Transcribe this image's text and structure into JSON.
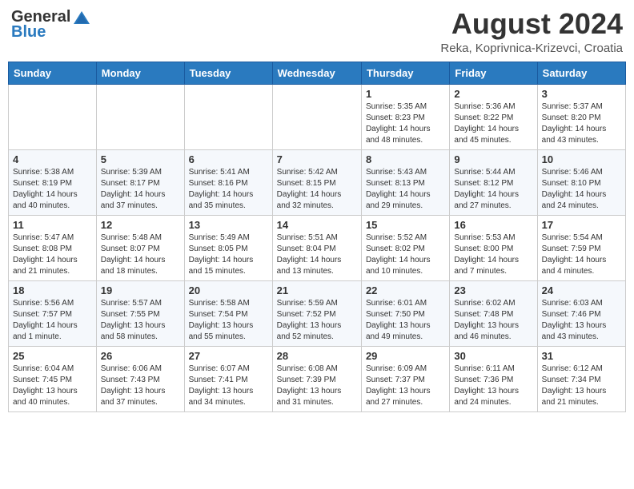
{
  "header": {
    "logo_general": "General",
    "logo_blue": "Blue",
    "month_year": "August 2024",
    "location": "Reka, Koprivnica-Krizevci, Croatia"
  },
  "weekdays": [
    "Sunday",
    "Monday",
    "Tuesday",
    "Wednesday",
    "Thursday",
    "Friday",
    "Saturday"
  ],
  "weeks": [
    [
      {
        "day": "",
        "info": ""
      },
      {
        "day": "",
        "info": ""
      },
      {
        "day": "",
        "info": ""
      },
      {
        "day": "",
        "info": ""
      },
      {
        "day": "1",
        "info": "Sunrise: 5:35 AM\nSunset: 8:23 PM\nDaylight: 14 hours\nand 48 minutes."
      },
      {
        "day": "2",
        "info": "Sunrise: 5:36 AM\nSunset: 8:22 PM\nDaylight: 14 hours\nand 45 minutes."
      },
      {
        "day": "3",
        "info": "Sunrise: 5:37 AM\nSunset: 8:20 PM\nDaylight: 14 hours\nand 43 minutes."
      }
    ],
    [
      {
        "day": "4",
        "info": "Sunrise: 5:38 AM\nSunset: 8:19 PM\nDaylight: 14 hours\nand 40 minutes."
      },
      {
        "day": "5",
        "info": "Sunrise: 5:39 AM\nSunset: 8:17 PM\nDaylight: 14 hours\nand 37 minutes."
      },
      {
        "day": "6",
        "info": "Sunrise: 5:41 AM\nSunset: 8:16 PM\nDaylight: 14 hours\nand 35 minutes."
      },
      {
        "day": "7",
        "info": "Sunrise: 5:42 AM\nSunset: 8:15 PM\nDaylight: 14 hours\nand 32 minutes."
      },
      {
        "day": "8",
        "info": "Sunrise: 5:43 AM\nSunset: 8:13 PM\nDaylight: 14 hours\nand 29 minutes."
      },
      {
        "day": "9",
        "info": "Sunrise: 5:44 AM\nSunset: 8:12 PM\nDaylight: 14 hours\nand 27 minutes."
      },
      {
        "day": "10",
        "info": "Sunrise: 5:46 AM\nSunset: 8:10 PM\nDaylight: 14 hours\nand 24 minutes."
      }
    ],
    [
      {
        "day": "11",
        "info": "Sunrise: 5:47 AM\nSunset: 8:08 PM\nDaylight: 14 hours\nand 21 minutes."
      },
      {
        "day": "12",
        "info": "Sunrise: 5:48 AM\nSunset: 8:07 PM\nDaylight: 14 hours\nand 18 minutes."
      },
      {
        "day": "13",
        "info": "Sunrise: 5:49 AM\nSunset: 8:05 PM\nDaylight: 14 hours\nand 15 minutes."
      },
      {
        "day": "14",
        "info": "Sunrise: 5:51 AM\nSunset: 8:04 PM\nDaylight: 14 hours\nand 13 minutes."
      },
      {
        "day": "15",
        "info": "Sunrise: 5:52 AM\nSunset: 8:02 PM\nDaylight: 14 hours\nand 10 minutes."
      },
      {
        "day": "16",
        "info": "Sunrise: 5:53 AM\nSunset: 8:00 PM\nDaylight: 14 hours\nand 7 minutes."
      },
      {
        "day": "17",
        "info": "Sunrise: 5:54 AM\nSunset: 7:59 PM\nDaylight: 14 hours\nand 4 minutes."
      }
    ],
    [
      {
        "day": "18",
        "info": "Sunrise: 5:56 AM\nSunset: 7:57 PM\nDaylight: 14 hours\nand 1 minute."
      },
      {
        "day": "19",
        "info": "Sunrise: 5:57 AM\nSunset: 7:55 PM\nDaylight: 13 hours\nand 58 minutes."
      },
      {
        "day": "20",
        "info": "Sunrise: 5:58 AM\nSunset: 7:54 PM\nDaylight: 13 hours\nand 55 minutes."
      },
      {
        "day": "21",
        "info": "Sunrise: 5:59 AM\nSunset: 7:52 PM\nDaylight: 13 hours\nand 52 minutes."
      },
      {
        "day": "22",
        "info": "Sunrise: 6:01 AM\nSunset: 7:50 PM\nDaylight: 13 hours\nand 49 minutes."
      },
      {
        "day": "23",
        "info": "Sunrise: 6:02 AM\nSunset: 7:48 PM\nDaylight: 13 hours\nand 46 minutes."
      },
      {
        "day": "24",
        "info": "Sunrise: 6:03 AM\nSunset: 7:46 PM\nDaylight: 13 hours\nand 43 minutes."
      }
    ],
    [
      {
        "day": "25",
        "info": "Sunrise: 6:04 AM\nSunset: 7:45 PM\nDaylight: 13 hours\nand 40 minutes."
      },
      {
        "day": "26",
        "info": "Sunrise: 6:06 AM\nSunset: 7:43 PM\nDaylight: 13 hours\nand 37 minutes."
      },
      {
        "day": "27",
        "info": "Sunrise: 6:07 AM\nSunset: 7:41 PM\nDaylight: 13 hours\nand 34 minutes."
      },
      {
        "day": "28",
        "info": "Sunrise: 6:08 AM\nSunset: 7:39 PM\nDaylight: 13 hours\nand 31 minutes."
      },
      {
        "day": "29",
        "info": "Sunrise: 6:09 AM\nSunset: 7:37 PM\nDaylight: 13 hours\nand 27 minutes."
      },
      {
        "day": "30",
        "info": "Sunrise: 6:11 AM\nSunset: 7:36 PM\nDaylight: 13 hours\nand 24 minutes."
      },
      {
        "day": "31",
        "info": "Sunrise: 6:12 AM\nSunset: 7:34 PM\nDaylight: 13 hours\nand 21 minutes."
      }
    ]
  ]
}
